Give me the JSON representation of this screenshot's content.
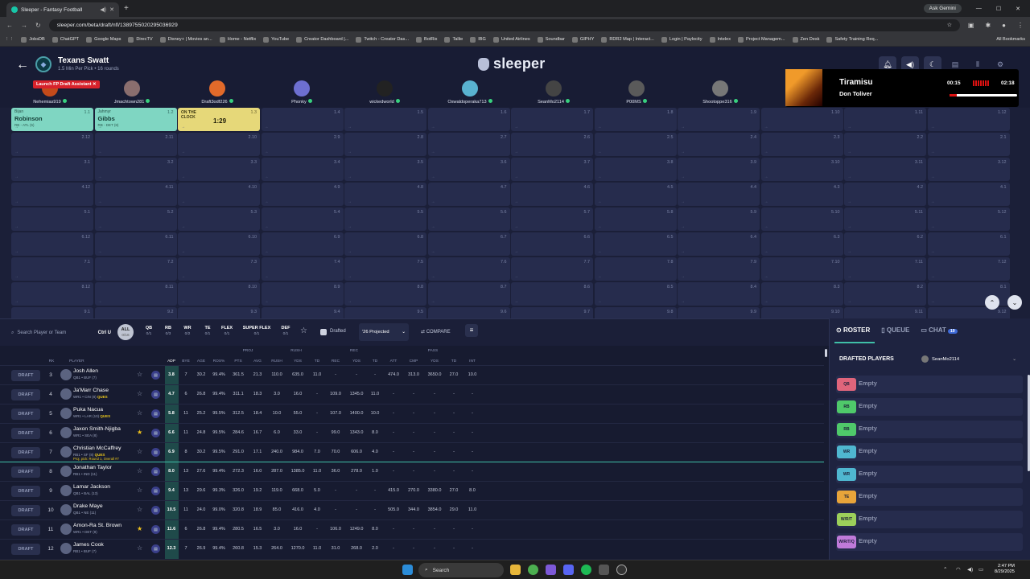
{
  "browser": {
    "tab_title": "Sleeper - Fantasy Football",
    "url": "sleeper.com/beta/draft/nfl/1389755020295036929",
    "ask_gemini": "Ask Gemini",
    "bookmarks": [
      "JobsDB",
      "ChatGPT",
      "Google Maps",
      "DirecTV",
      "Disney+ | Movies an...",
      "Home - Netflix",
      "YouTube",
      "Creator Dashboard |...",
      "Twitch - Creator Das...",
      "BotRix",
      "Tallie",
      "IBG",
      "United Airlines",
      "Soundbar",
      "GIPHY",
      "RDR2 Map | Interact...",
      "Login | Paylocity",
      "Intelex",
      "Project Managem...",
      "Zen Desk",
      "Safety Training Req..."
    ],
    "all_bookmarks": "All Bookmarks"
  },
  "header": {
    "league_name": "Texans Swatt",
    "league_sub": "1.5 Min Per Pick • 16 rounds",
    "logo": "sleeper",
    "fp_button": "Launch FP Draft Assistant",
    "teams": [
      "Nehemias919",
      "Jmachtown281",
      "Draft3odf226",
      "Phonky",
      "wickedworld",
      "Oswaldoperaka713",
      "SeanMo2114",
      "P00MS",
      "Shootoppe316"
    ]
  },
  "music": {
    "song": "Tiramisu",
    "artist": "Don Toliver",
    "elapsed": "00:15",
    "total": "02:18",
    "progress": 0.11
  },
  "board": {
    "picks": [
      {
        "first": "Bijan",
        "last": "Robinson",
        "info": "RB - ATL (5)"
      },
      {
        "first": "Jahmyr",
        "last": "Gibbs",
        "info": "RB - DET (8)"
      }
    ],
    "clock_label": "ON THE CLOCK",
    "clock_time": "1:29",
    "rows": [
      [
        "1.1",
        "1.2",
        "1.3",
        "1.4",
        "1.5",
        "1.6",
        "1.7",
        "1.8",
        "1.9",
        "1.10",
        "1.11",
        "1.12"
      ],
      [
        "2.12",
        "2.11",
        "2.10",
        "2.9",
        "2.8",
        "2.7",
        "2.6",
        "2.5",
        "2.4",
        "2.3",
        "2.2",
        "2.1"
      ],
      [
        "3.1",
        "3.2",
        "3.3",
        "3.4",
        "3.5",
        "3.6",
        "3.7",
        "3.8",
        "3.9",
        "3.10",
        "3.11",
        "3.12"
      ],
      [
        "4.12",
        "4.11",
        "4.10",
        "4.9",
        "4.8",
        "4.7",
        "4.6",
        "4.5",
        "4.4",
        "4.3",
        "4.2",
        "4.1"
      ],
      [
        "5.1",
        "5.2",
        "5.3",
        "5.4",
        "5.5",
        "5.6",
        "5.7",
        "5.8",
        "5.9",
        "5.10",
        "5.11",
        "5.12"
      ],
      [
        "6.12",
        "6.11",
        "6.10",
        "6.9",
        "6.8",
        "6.7",
        "6.6",
        "6.5",
        "6.4",
        "6.3",
        "6.2",
        "6.1"
      ],
      [
        "7.1",
        "7.2",
        "7.3",
        "7.4",
        "7.5",
        "7.6",
        "7.7",
        "7.8",
        "7.9",
        "7.10",
        "7.11",
        "7.12"
      ],
      [
        "8.12",
        "8.11",
        "8.10",
        "8.9",
        "8.8",
        "8.7",
        "8.6",
        "8.5",
        "8.4",
        "8.3",
        "8.2",
        "8.1"
      ],
      [
        "9.1",
        "9.2",
        "9.3",
        "9.4",
        "9.5",
        "9.6",
        "9.7",
        "9.8",
        "9.9",
        "9.10",
        "9.11",
        "9.12"
      ]
    ]
  },
  "toolbar": {
    "search_placeholder": "Search Player or Team",
    "shortcut": "Ctrl U",
    "positions": [
      {
        "label": "ALL",
        "count": "0/16"
      },
      {
        "label": "QB",
        "count": "0/1"
      },
      {
        "label": "RB",
        "count": "0/3"
      },
      {
        "label": "WR",
        "count": "0/2"
      },
      {
        "label": "TE",
        "count": "0/1"
      },
      {
        "label": "FLEX",
        "count": "0/1"
      },
      {
        "label": "SUPER FLEX",
        "count": "0/1"
      },
      {
        "label": "DEF",
        "count": "0/1"
      }
    ],
    "drafted": "Drafted",
    "projection": "'26 Projected",
    "compare": "COMPARE"
  },
  "table": {
    "groups": [
      "PROJ",
      "RUSH",
      "REC",
      "PASS"
    ],
    "columns": [
      "RK",
      "PLAYER",
      "ADP",
      "BYE",
      "AGE",
      "ROS%",
      "PTS",
      "AVG",
      "RUSH",
      "YDS",
      "TD",
      "REC",
      "YDS",
      "TD",
      "ATT",
      "CMP",
      "YDS",
      "TD",
      "INT"
    ],
    "draft_label": "DRAFT",
    "rows": [
      {
        "rk": "3",
        "name": "Josh Allen",
        "detail": "QB1 • BUF (7)",
        "tag": "",
        "proj": "",
        "star": false,
        "vals": [
          "3.8",
          "7",
          "30.2",
          "99.4%",
          "361.5",
          "21.3",
          "110.0",
          "635.0",
          "11.0",
          "-",
          "-",
          "-",
          "474.0",
          "313.0",
          "3650.0",
          "27.0",
          "10.0"
        ]
      },
      {
        "rk": "4",
        "name": "Ja'Marr Chase",
        "detail": "WR1 • CIN (8)",
        "tag": "QUES",
        "proj": "",
        "star": false,
        "vals": [
          "4.7",
          "6",
          "26.8",
          "99.4%",
          "311.1",
          "18.3",
          "3.0",
          "16.0",
          "-",
          "109.0",
          "1345.0",
          "11.0",
          "-",
          "-",
          "-",
          "-",
          "-"
        ]
      },
      {
        "rk": "5",
        "name": "Puka Nacua",
        "detail": "WR1 • LAR (10)",
        "tag": "QUES",
        "proj": "",
        "star": false,
        "vals": [
          "5.8",
          "11",
          "25.2",
          "99.5%",
          "312.5",
          "18.4",
          "10.0",
          "55.0",
          "-",
          "107.0",
          "1400.0",
          "10.0",
          "-",
          "-",
          "-",
          "-",
          "-"
        ]
      },
      {
        "rk": "6",
        "name": "Jaxon Smith-Njigba",
        "detail": "WR1 • SEA (8)",
        "tag": "",
        "proj": "",
        "star": true,
        "vals": [
          "6.6",
          "11",
          "24.8",
          "99.5%",
          "284.6",
          "16.7",
          "6.0",
          "33.0",
          "-",
          "99.0",
          "1343.0",
          "8.0",
          "-",
          "-",
          "-",
          "-",
          "-"
        ]
      },
      {
        "rk": "7",
        "name": "Christian McCaffrey",
        "detail": "RB1 • SF (8)",
        "tag": "QUES",
        "proj": "Proj. pick: Round 1, Overall #7",
        "star": false,
        "vals": [
          "6.9",
          "8",
          "30.2",
          "99.5%",
          "291.0",
          "17.1",
          "240.0",
          "984.0",
          "7.0",
          "70.0",
          "606.0",
          "4.0",
          "-",
          "-",
          "-",
          "-",
          "-"
        ]
      },
      {
        "rk": "8",
        "name": "Jonathan Taylor",
        "detail": "RB1 • IND (11)",
        "tag": "",
        "proj": "",
        "star": false,
        "vals": [
          "8.0",
          "13",
          "27.6",
          "99.4%",
          "272.3",
          "16.0",
          "287.0",
          "1385.0",
          "11.0",
          "36.0",
          "278.0",
          "1.0",
          "-",
          "-",
          "-",
          "-",
          "-"
        ]
      },
      {
        "rk": "9",
        "name": "Lamar Jackson",
        "detail": "QB1 • BAL (13)",
        "tag": "",
        "proj": "",
        "star": false,
        "vals": [
          "9.4",
          "13",
          "29.6",
          "99.3%",
          "326.0",
          "19.2",
          "119.0",
          "668.0",
          "5.0",
          "-",
          "-",
          "-",
          "415.0",
          "270.0",
          "3380.0",
          "27.0",
          "8.0"
        ]
      },
      {
        "rk": "10",
        "name": "Drake Maye",
        "detail": "QB1 • NE (11)",
        "tag": "",
        "proj": "",
        "star": false,
        "vals": [
          "10.5",
          "11",
          "24.0",
          "99.0%",
          "320.8",
          "18.9",
          "85.0",
          "416.0",
          "4.0",
          "-",
          "-",
          "-",
          "505.0",
          "344.0",
          "3854.0",
          "29.0",
          "11.0"
        ]
      },
      {
        "rk": "11",
        "name": "Amon-Ra St. Brown",
        "detail": "WR1 • DET (8)",
        "tag": "",
        "proj": "",
        "star": true,
        "vals": [
          "11.6",
          "6",
          "26.8",
          "99.4%",
          "280.5",
          "16.5",
          "3.0",
          "16.0",
          "-",
          "106.0",
          "1249.0",
          "8.0",
          "-",
          "-",
          "-",
          "-",
          "-"
        ]
      },
      {
        "rk": "12",
        "name": "James Cook",
        "detail": "RB1 • BUF (7)",
        "tag": "",
        "proj": "",
        "star": false,
        "vals": [
          "12.3",
          "7",
          "26.9",
          "99.4%",
          "260.8",
          "15.3",
          "264.0",
          "1270.0",
          "11.0",
          "31.0",
          "268.0",
          "2.0",
          "-",
          "-",
          "-",
          "-",
          "-"
        ]
      }
    ]
  },
  "right_panel": {
    "tabs": [
      "ROSTER",
      "QUEUE",
      "CHAT"
    ],
    "chat_count": "19",
    "drafted_title": "DRAFTED PLAYERS",
    "drafted_user": "SeanMo2114",
    "slots": [
      {
        "pos": "QB",
        "color": "#e0657b",
        "label": "Empty"
      },
      {
        "pos": "RB",
        "color": "#4fc96a",
        "label": "Empty"
      },
      {
        "pos": "RB",
        "color": "#4fc96a",
        "label": "Empty"
      },
      {
        "pos": "WR",
        "color": "#4fb7d0",
        "label": "Empty"
      },
      {
        "pos": "WR",
        "color": "#4fb7d0",
        "label": "Empty"
      },
      {
        "pos": "TE",
        "color": "#e8a43a",
        "label": "Empty"
      },
      {
        "pos": "W/R/T",
        "color": "#9ccf5a",
        "label": "Empty"
      },
      {
        "pos": "W/R/T/Q",
        "color": "#c07ad9",
        "label": "Empty"
      }
    ]
  },
  "taskbar": {
    "search": "Search",
    "time": "2:47 PM",
    "date": "8/29/2025"
  }
}
